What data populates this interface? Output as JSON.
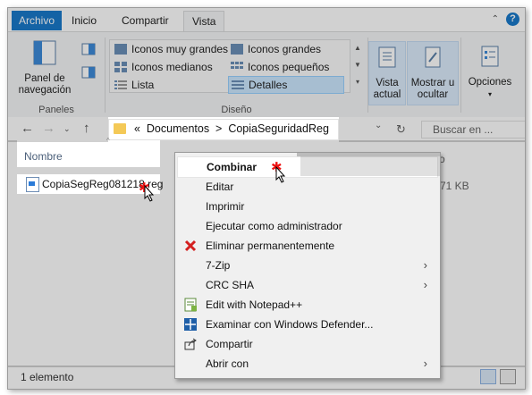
{
  "ribbon_tabs": [
    "Archivo",
    "Inicio",
    "Compartir",
    "Vista"
  ],
  "ribbon": {
    "nav_pane_label": "Panel de navegación",
    "panes_group": "Paneles",
    "layout_items": [
      "Iconos muy grandes",
      "Iconos grandes",
      "Iconos medianos",
      "Iconos pequeños",
      "Lista",
      "Detalles"
    ],
    "layout_group": "Diseño",
    "current_view_label": "Vista actual",
    "show_hide_label": "Mostrar u ocultar",
    "options_label": "Opciones"
  },
  "address": {
    "separator": "«",
    "path_1": "Documentos",
    "arrow": ">",
    "path_2": "CopiaSeguridadReg",
    "search_placeholder": "Buscar en ..."
  },
  "files": {
    "column_name": "Nombre",
    "column_2_partial": "o",
    "file_name": "CopiaSegReg081218.reg",
    "file_size": "71 KB"
  },
  "status": {
    "count": "1 elemento"
  },
  "context_menu": [
    {
      "label": "Combinar",
      "bold": true,
      "icon": "none",
      "submenu": false
    },
    {
      "label": "Editar",
      "bold": false,
      "icon": "none",
      "submenu": false
    },
    {
      "label": "Imprimir",
      "bold": false,
      "icon": "none",
      "submenu": false
    },
    {
      "label": "Ejecutar como administrador",
      "bold": false,
      "icon": "none",
      "submenu": false
    },
    {
      "label": "Eliminar permanentemente",
      "bold": false,
      "icon": "red-x-icon",
      "submenu": false
    },
    {
      "label": "7-Zip",
      "bold": false,
      "icon": "none",
      "submenu": true
    },
    {
      "label": "CRC SHA",
      "bold": false,
      "icon": "none",
      "submenu": true
    },
    {
      "label": "Edit with Notepad++",
      "bold": false,
      "icon": "notepad-plus-plus-icon",
      "submenu": false
    },
    {
      "label": "Examinar con Windows Defender...",
      "bold": false,
      "icon": "windows-defender-icon",
      "submenu": false
    },
    {
      "label": "Compartir",
      "bold": false,
      "icon": "share-icon",
      "submenu": false
    },
    {
      "label": "Abrir con",
      "bold": false,
      "icon": "none",
      "submenu": true
    }
  ],
  "colors": {
    "file_tab": "#1979ca",
    "selection": "#cce8ff",
    "annotation_star": "#e11111"
  }
}
